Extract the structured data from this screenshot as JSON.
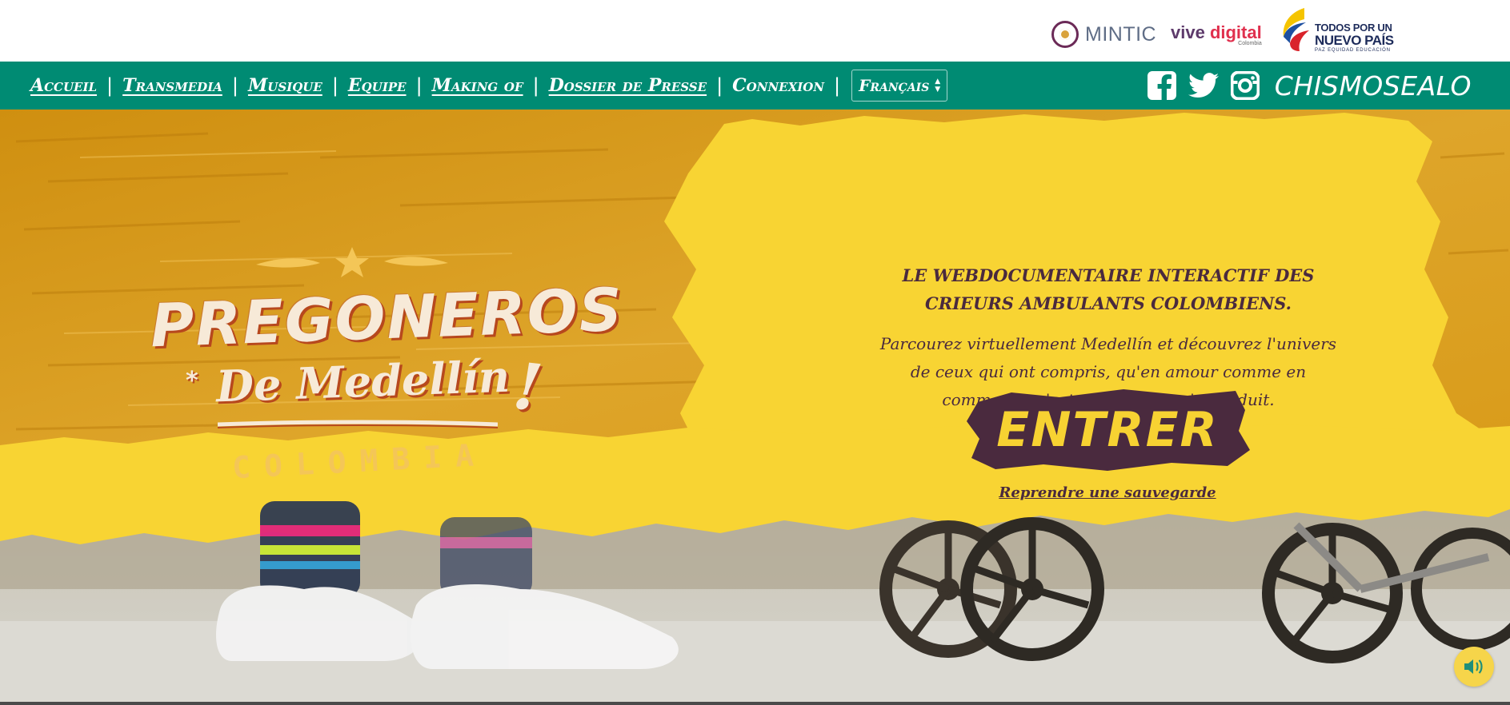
{
  "sponsors": {
    "mintic": "MINTIC",
    "vive_a": "vive ",
    "vive_b": "digital",
    "vive_sub": "Colombia",
    "todos_line1": "TODOS POR UN",
    "todos_line2": "NUEVO PAÍS",
    "todos_line3": "PAZ  EQUIDAD  EDUCACIÓN"
  },
  "nav": {
    "items": [
      {
        "label": "Accueil"
      },
      {
        "label": "Transmedia"
      },
      {
        "label": "Musique"
      },
      {
        "label": "Equipe"
      },
      {
        "label": "Making of"
      },
      {
        "label": "Dossier de Presse"
      },
      {
        "label": "Connexion"
      }
    ],
    "separator": "|",
    "language": {
      "selected": "Français"
    },
    "social": [
      "facebook-icon",
      "twitter-icon",
      "instagram-icon"
    ],
    "chismosealo": "CHISMOSEALO"
  },
  "hero": {
    "title_main": "PREGONEROS",
    "title_sub": "De Medellín",
    "asterisk": "*",
    "exclaim": "!",
    "country": "COLOMBIA",
    "heading": "LE WEBDOCUMENTAIRE INTERACTIF DES CRIEURS AMBULANTS COLOMBIENS.",
    "body": "Parcourez virtuellement Medellín et découvrez l'univers de ceux qui ont compris, qu'en amour comme en commerce, c'est par la voix qu'on séduit.",
    "enter": "ENTRER",
    "resume": "Reprendre une sauvegarde"
  },
  "colors": {
    "nav_green": "#008b73",
    "yellow": "#f7d232",
    "ochre": "#d99b17",
    "plum": "#4a2a3e"
  },
  "icons": [
    "sound-icon",
    "star-icon"
  ]
}
